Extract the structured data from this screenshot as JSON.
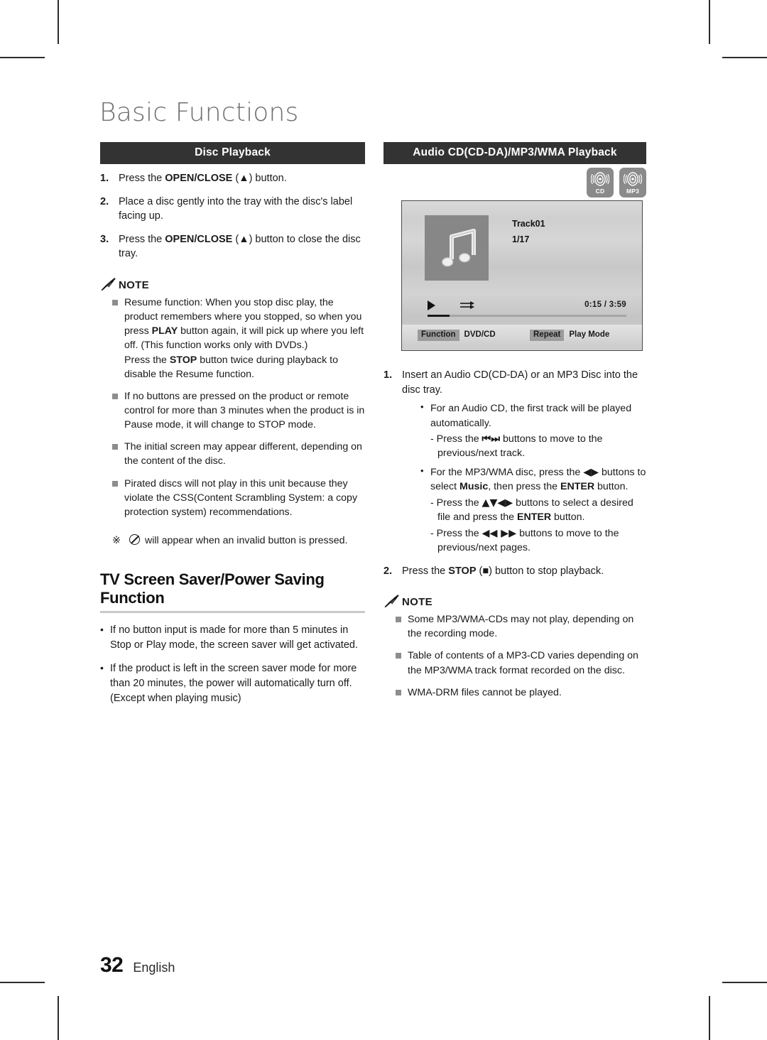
{
  "page": {
    "chapter_title": "Basic Functions",
    "page_number": "32",
    "language": "English"
  },
  "left_column": {
    "section_title": "Disc Playback",
    "steps": [
      {
        "num": "1.",
        "text_before": "Press the ",
        "bold": "OPEN/CLOSE",
        "text_after": " (▲) button."
      },
      {
        "num": "2.",
        "text_before": "Place a disc gently into the tray with the disc's label facing up.",
        "bold": "",
        "text_after": ""
      },
      {
        "num": "3.",
        "text_before": "Press the ",
        "bold": "OPEN/CLOSE",
        "text_after": " (▲) button to close the disc tray."
      }
    ],
    "note": {
      "label": "NOTE",
      "icon": "pencil-icon",
      "items": [
        {
          "part1": "Resume function: When you stop disc play, the product remembers where you stopped, so when you press ",
          "bold1": "PLAY",
          "part2": " button again, it will pick up where you left off. (This function works only with DVDs.)",
          "para2_part1": "Press the ",
          "para2_bold": "STOP",
          "para2_part2": " button twice during playback to disable the Resume function."
        },
        {
          "part1": "If no buttons are pressed on the product or remote control for more than 3 minutes when the product is in Pause mode, it will change to STOP mode.",
          "bold1": "",
          "part2": "",
          "para2_part1": "",
          "para2_bold": "",
          "para2_part2": ""
        },
        {
          "part1": "The initial screen may appear different, depending on the content of the disc.",
          "bold1": "",
          "part2": "",
          "para2_part1": "",
          "para2_bold": "",
          "para2_part2": ""
        },
        {
          "part1": "Pirated discs will not play in this unit because they violate the CSS(Content Scrambling System: a copy protection system) recommendations.",
          "bold1": "",
          "part2": "",
          "para2_part1": "",
          "para2_bold": "",
          "para2_part2": ""
        }
      ]
    },
    "star_note": {
      "symbol": "※",
      "text": "will appear when an invalid button is pressed."
    },
    "sub_heading": "TV Screen Saver/Power Saving Function",
    "bullets": [
      "If no button input is made for more than 5 minutes in Stop or Play mode, the screen saver will get activated.",
      "If the product is left in the screen saver mode for more than 20 minutes, the power will automatically turn off. (Except when playing music)"
    ]
  },
  "right_column": {
    "section_title": "Audio CD(CD-DA)/MP3/WMA Playback",
    "media_chips": [
      {
        "label": "CD",
        "icon": "disc-icon"
      },
      {
        "label": "MP3",
        "icon": "disc-icon"
      }
    ],
    "osd": {
      "track_name": "Track01",
      "track_index": "1/17",
      "elapsed_total": "0:15  /  3:59",
      "play_icon": "play-icon",
      "repeat_icon": "repeat-icon",
      "album_icon": "music-note-icon",
      "progress_percent": 11,
      "status": {
        "function_tag": "Function",
        "function_value": "DVD/CD",
        "repeat_tag": "Repeat",
        "repeat_value": "Play Mode"
      }
    },
    "steps": [
      {
        "num": "1.",
        "text": "Insert an Audio CD(CD-DA) or an MP3 Disc into the disc tray.",
        "inner": [
          {
            "text": "For an Audio CD, the first track will be played automatically.",
            "dashes": [
              {
                "pre": "- Press the ",
                "glyph": "⏮⏭",
                "post": " buttons to move to the previous/next track."
              }
            ]
          },
          {
            "pre": "For the MP3/WMA disc, press the ",
            "glyph": "◀▶",
            "mid": " buttons to select ",
            "bold1": "Music",
            "mid2": ", then press the ",
            "bold2": "ENTER",
            "post": " button.",
            "dashes": [
              {
                "pre": "- Press the ",
                "glyph": "▲▼◀▶",
                "mid": " buttons to select  a desired file and press the ",
                "bold": "ENTER",
                "post": " button."
              },
              {
                "pre": "- Press the ",
                "glyph": "◀◀ ▶▶",
                "post": " buttons to move to the previous/next pages."
              }
            ]
          }
        ]
      },
      {
        "num": "2.",
        "pre": "Press the ",
        "bold": "STOP",
        "post": " (■) button to stop playback."
      }
    ],
    "note": {
      "label": "NOTE",
      "icon": "pencil-icon",
      "items": [
        "Some MP3/WMA-CDs may not play, depending on the recording mode.",
        "Table of contents of a MP3-CD varies depending on the MP3/WMA track format recorded on the disc.",
        "WMA-DRM files cannot be played."
      ]
    }
  },
  "colors": {
    "section_bar": "#333333",
    "note_square": "#8d8d8d",
    "rule": "#c9c9c9",
    "chip": "#8a8a8a",
    "chapter_title": "#6f6f6f"
  }
}
